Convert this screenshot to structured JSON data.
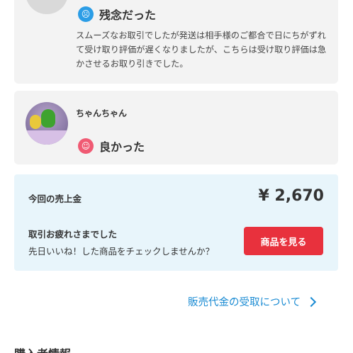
{
  "review1": {
    "rating": "残念だった",
    "rating_icon": "sad-face-icon",
    "body": "スムーズなお取引でしたが発送は相手様のご都合で日にちがずれて受け取り評価が遅くなりましたが、こちらは受け取り評価は急かさせるお取り引きでした。"
  },
  "review2": {
    "username": "ちゃんちゃん",
    "rating": "良かった",
    "rating_icon": "happy-face-icon"
  },
  "sales": {
    "label": "今回の売上金",
    "amount": "¥ 2,670",
    "thanks_title": "取引お疲れさまでした",
    "thanks_sub": "先日いいね！した商品をチェックしませんか？",
    "button_label": "商品を見る"
  },
  "link": {
    "label": "販売代金の受取について"
  },
  "section": {
    "heading": "購入者情報"
  },
  "colors": {
    "sad_icon": "#2b9de6",
    "happy_icon": "#f05a73",
    "button": "#e8313d",
    "link": "#1a8bd3",
    "sales_bg": "#e8f5fb"
  }
}
